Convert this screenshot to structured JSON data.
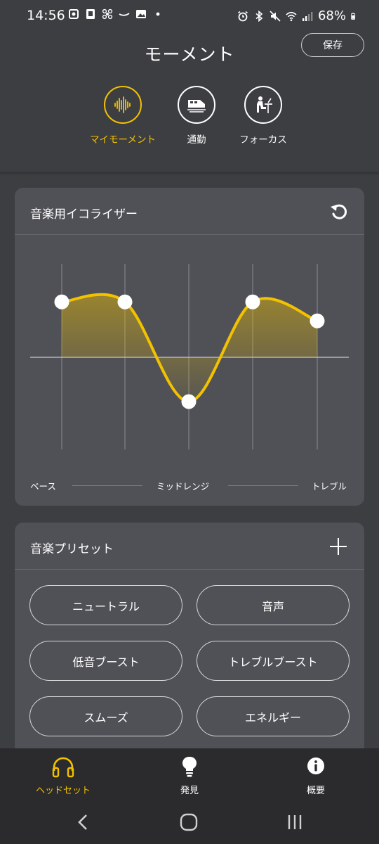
{
  "status_bar": {
    "time": "14:56",
    "battery": "68%"
  },
  "header": {
    "title": "モーメント",
    "save_label": "保存"
  },
  "moments": [
    {
      "label": "マイモーメント",
      "icon": "sound-wave-icon",
      "active": true
    },
    {
      "label": "通勤",
      "icon": "train-icon",
      "active": false
    },
    {
      "label": "フォーカス",
      "icon": "desk-worker-icon",
      "active": false
    }
  ],
  "equalizer": {
    "title": "音楽用イコライザー",
    "band_labels": {
      "bass": "ベース",
      "mid": "ミッドレンジ",
      "treble": "トレブル"
    },
    "band_levels": [
      0.35,
      0.35,
      -0.28,
      0.35,
      0.23
    ],
    "accent_color": "#f2c200"
  },
  "presets": {
    "title": "音楽プリセット",
    "items": [
      "ニュートラル",
      "音声",
      "低音ブースト",
      "トレブルブースト",
      "スムーズ",
      "エネルギー"
    ]
  },
  "bottom_nav": [
    {
      "label": "ヘッドセット",
      "icon": "headphones-icon",
      "active": true
    },
    {
      "label": "発見",
      "icon": "lightbulb-icon",
      "active": false
    },
    {
      "label": "概要",
      "icon": "info-icon",
      "active": false
    }
  ]
}
